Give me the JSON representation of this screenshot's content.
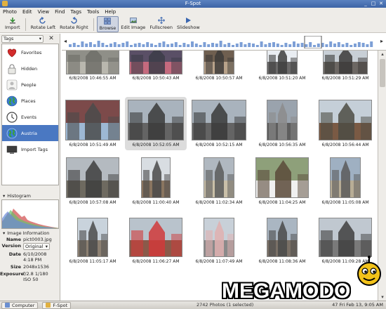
{
  "window": {
    "title": "F-Spot"
  },
  "menu": [
    "Photo",
    "Edit",
    "View",
    "Find",
    "Tags",
    "Tools",
    "Help"
  ],
  "toolbar": {
    "import": "Import",
    "rotate_left": "Rotate Left",
    "rotate_right": "Rotate Right",
    "browse": "Browse",
    "edit_image": "Edit Image",
    "fullscreen": "Fullscreen",
    "slideshow": "Slideshow"
  },
  "tags_panel": {
    "selector": "Tags",
    "items": [
      {
        "label": "Favorites",
        "icon": "heart-icon"
      },
      {
        "label": "Hidden",
        "icon": "lock-icon"
      },
      {
        "label": "People",
        "icon": "person-icon"
      },
      {
        "label": "Places",
        "icon": "globe-icon"
      },
      {
        "label": "Events",
        "icon": "clock-icon"
      },
      {
        "label": "Austria",
        "icon": "globe-icon",
        "selected": true
      },
      {
        "label": "Import Tags",
        "icon": "monitor-icon"
      }
    ]
  },
  "histogram": {
    "label": "Histogram"
  },
  "image_info": {
    "label": "Image Information",
    "name_key": "Name",
    "name": "pict0003.jpg",
    "version_key": "Version",
    "version": "Original",
    "date_key": "Date",
    "date_line1": "6/10/2008",
    "date_line2": "4:18 PM",
    "size_key": "Size",
    "size": "2048x1536",
    "exposure_key": "Exposure",
    "exposure_line1": "f/2.8 1/180",
    "exposure_line2": "ISO 50"
  },
  "photos": [
    {
      "caption": "6/8/2008 10:46:55 AM"
    },
    {
      "caption": "6/8/2008 10:50:43 AM"
    },
    {
      "caption": "6/8/2008 10:50:57 AM"
    },
    {
      "caption": "6/8/2008 10:51:20 AM"
    },
    {
      "caption": "6/8/2008 10:51:29 AM"
    },
    {
      "caption": "6/8/2008 10:51:49 AM"
    },
    {
      "caption": "6/8/2008 10:52:05 AM"
    },
    {
      "caption": "6/8/2008 10:52:15 AM"
    },
    {
      "caption": "6/8/2008 10:56:35 AM"
    },
    {
      "caption": "6/8/2008 10:56:44 AM"
    },
    {
      "caption": "6/8/2008 10:57:08 AM"
    },
    {
      "caption": "6/8/2008 11:00:40 AM"
    },
    {
      "caption": "6/8/2008 11:02:34 AM"
    },
    {
      "caption": "6/8/2008 11:04:25 AM"
    },
    {
      "caption": "6/8/2008 11:05:08 AM"
    },
    {
      "caption": "6/8/2008 11:05:17 AM"
    },
    {
      "caption": "6/8/2008 11:06:27 AM"
    },
    {
      "caption": "6/8/2008 11:07:49 AM"
    },
    {
      "caption": "6/8/2008 11:08:36 AM"
    },
    {
      "caption": "6/8/2008 11:09:28 AM"
    }
  ],
  "status": {
    "count": "2742 Photos (1 selected)"
  },
  "taskbar": {
    "computer": "Computer",
    "fspot": "F-Spot",
    "clock": "Fri Feb 13, 9:05 AM",
    "volume": "47"
  },
  "watermark": {
    "text": "MEGAMODO"
  },
  "colors": {
    "selection": "#4a78c2",
    "titlebar": "#3d64a6",
    "timeline_bar": "#7d9fd6"
  }
}
